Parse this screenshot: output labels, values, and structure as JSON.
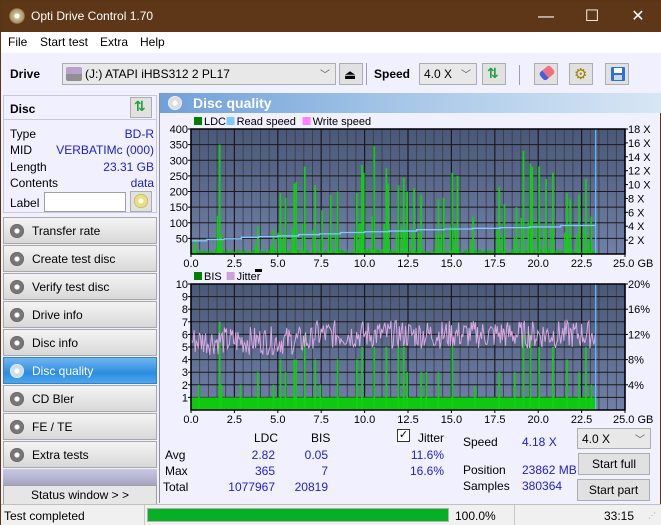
{
  "window": {
    "title": "Opti Drive Control 1.70",
    "minimize": "—",
    "maximize": "☐",
    "close": "✕"
  },
  "menu": [
    "File",
    "Start test",
    "Extra",
    "Help"
  ],
  "toolbar": {
    "drive_label": "Drive",
    "drive_value": "(J:)  ATAPI iHBS312   2 PL17",
    "speed_label": "Speed",
    "speed_value": "4.0 X",
    "icons": [
      "eject-icon",
      "refresh-icon",
      "eraser-icon",
      "settings-icon",
      "save-icon"
    ]
  },
  "disc": {
    "title": "Disc",
    "rows": [
      {
        "key": "Type",
        "value": "BD-R"
      },
      {
        "key": "MID",
        "value": "VERBATIMc (000)"
      },
      {
        "key": "Length",
        "value": "23.31 GB"
      },
      {
        "key": "Contents",
        "value": "data"
      }
    ],
    "label_key": "Label",
    "label_value": ""
  },
  "nav": [
    {
      "label": "Transfer rate",
      "active": false
    },
    {
      "label": "Create test disc",
      "active": false
    },
    {
      "label": "Verify test disc",
      "active": false
    },
    {
      "label": "Drive info",
      "active": false
    },
    {
      "label": "Disc info",
      "active": false
    },
    {
      "label": "Disc quality",
      "active": true
    },
    {
      "label": "CD Bler",
      "active": false
    },
    {
      "label": "FE / TE",
      "active": false
    },
    {
      "label": "Extra tests",
      "active": false
    }
  ],
  "status_window_label": "Status window > >",
  "panel_title": "Disc quality",
  "chart_data": [
    {
      "type": "bar",
      "title": "LDC / Read speed",
      "legend": [
        "LDC",
        "Read speed",
        "Write speed"
      ],
      "legend_colors": [
        "#008000",
        "#80c8ff",
        "#ff80ff"
      ],
      "xlim": [
        0,
        25
      ],
      "x_ticks": [
        "0.0",
        "2.5",
        "5.0",
        "7.5",
        "10.0",
        "12.5",
        "15.0",
        "17.5",
        "20.0",
        "22.5",
        "25.0 GB"
      ],
      "ylim": [
        0,
        400
      ],
      "y_ticks": [
        "50",
        "100",
        "150",
        "200",
        "250",
        "300",
        "350",
        "400"
      ],
      "y2lim": [
        0,
        18
      ],
      "y2_ticks": [
        "2 X",
        "4 X",
        "6 X",
        "8 X",
        "10 X",
        "12 X",
        "14 X",
        "16 X",
        "18 X"
      ],
      "end_position_gb": 23.31,
      "ldc_peaks": [
        [
          0.2,
          40
        ],
        [
          1.6,
          350
        ],
        [
          1.7,
          60
        ],
        [
          3.8,
          90
        ],
        [
          4.7,
          80
        ],
        [
          5.1,
          195
        ],
        [
          5.4,
          180
        ],
        [
          5.9,
          225
        ],
        [
          6.0,
          230
        ],
        [
          6.5,
          280
        ],
        [
          7.1,
          220
        ],
        [
          7.5,
          140
        ],
        [
          8.0,
          190
        ],
        [
          8.4,
          200
        ],
        [
          9.5,
          195
        ],
        [
          9.8,
          285
        ],
        [
          9.9,
          260
        ],
        [
          10.5,
          345
        ],
        [
          11.2,
          275
        ],
        [
          11.3,
          225
        ],
        [
          11.9,
          220
        ],
        [
          12.2,
          245
        ],
        [
          12.4,
          200
        ],
        [
          12.8,
          210
        ],
        [
          13.2,
          190
        ],
        [
          14.2,
          175
        ],
        [
          14.5,
          180
        ],
        [
          15.0,
          260
        ],
        [
          15.3,
          250
        ],
        [
          16.2,
          120
        ],
        [
          17.7,
          215
        ],
        [
          18.0,
          160
        ],
        [
          18.7,
          150
        ],
        [
          19.1,
          330
        ],
        [
          19.5,
          290
        ],
        [
          19.6,
          280
        ],
        [
          20.0,
          280
        ],
        [
          20.4,
          240
        ],
        [
          20.8,
          260
        ],
        [
          21.6,
          195
        ],
        [
          21.8,
          175
        ],
        [
          22.3,
          190
        ],
        [
          22.7,
          240
        ],
        [
          23.0,
          120
        ]
      ],
      "read_speed_steps": [
        [
          0,
          1.9
        ],
        [
          0.9,
          2.1
        ],
        [
          1.9,
          2.2
        ],
        [
          2.9,
          2.4
        ],
        [
          3.9,
          2.5
        ],
        [
          5.0,
          2.6
        ],
        [
          6.2,
          2.8
        ],
        [
          7.4,
          2.9
        ],
        [
          8.6,
          3.1
        ],
        [
          10.0,
          3.2
        ],
        [
          11.4,
          3.3
        ],
        [
          13.0,
          3.5
        ],
        [
          14.6,
          3.6
        ],
        [
          16.2,
          3.7
        ],
        [
          17.8,
          3.8
        ],
        [
          19.5,
          3.9
        ],
        [
          21.3,
          4.1
        ],
        [
          23.31,
          4.1
        ]
      ]
    },
    {
      "type": "bar",
      "title": "BIS / Jitter",
      "legend": [
        "BIS",
        "Jitter"
      ],
      "legend_colors": [
        "#008000",
        "#d0a0d8"
      ],
      "xlim": [
        0,
        25
      ],
      "x_ticks": [
        "0.0",
        "2.5",
        "5.0",
        "7.5",
        "10.0",
        "12.5",
        "15.0",
        "17.5",
        "20.0",
        "22.5",
        "25.0 GB"
      ],
      "ylim": [
        0,
        10
      ],
      "y_ticks": [
        "1",
        "2",
        "3",
        "4",
        "5",
        "6",
        "7",
        "8",
        "9",
        "10"
      ],
      "y2lim": [
        0,
        20
      ],
      "y2_ticks": [
        "4%",
        "8%",
        "12%",
        "16%",
        "20%"
      ],
      "end_position_gb": 23.31,
      "bis_baseline": 1,
      "bis_peaks": [
        [
          0.4,
          2
        ],
        [
          1.6,
          7
        ],
        [
          1.7,
          2
        ],
        [
          2.8,
          2
        ],
        [
          3.8,
          3
        ],
        [
          4.7,
          2
        ],
        [
          5.1,
          4
        ],
        [
          5.4,
          3
        ],
        [
          5.9,
          4
        ],
        [
          6.0,
          4
        ],
        [
          6.5,
          6
        ],
        [
          7.1,
          4
        ],
        [
          7.4,
          2
        ],
        [
          8.4,
          4
        ],
        [
          9.5,
          4
        ],
        [
          9.8,
          5
        ],
        [
          10.5,
          5
        ],
        [
          11.2,
          5
        ],
        [
          11.9,
          5
        ],
        [
          12.2,
          5
        ],
        [
          12.4,
          3
        ],
        [
          13.2,
          3
        ],
        [
          13.5,
          3
        ],
        [
          14.2,
          3
        ],
        [
          15.0,
          5
        ],
        [
          16.3,
          1.9
        ],
        [
          17.7,
          3
        ],
        [
          18.6,
          3
        ],
        [
          19.1,
          6
        ],
        [
          19.5,
          6
        ],
        [
          20.0,
          5
        ],
        [
          20.8,
          5
        ],
        [
          21.6,
          4
        ],
        [
          22.3,
          3
        ],
        [
          22.7,
          5
        ],
        [
          23.0,
          2
        ]
      ],
      "jitter_range_percent": [
        9,
        16.6
      ]
    }
  ],
  "stats": {
    "col_ldc": "LDC",
    "col_bis": "BIS",
    "jitter_label": "Jitter",
    "jitter_checked": true,
    "rows": [
      {
        "label": "Avg",
        "ldc": "2.82",
        "bis": "0.05",
        "jitter": "11.6%"
      },
      {
        "label": "Max",
        "ldc": "365",
        "bis": "7",
        "jitter": "16.6%"
      },
      {
        "label": "Total",
        "ldc": "1077967",
        "bis": "20819",
        "jitter": ""
      }
    ],
    "speed_label": "Speed",
    "speed_value": "4.18 X",
    "position_label": "Position",
    "position_value": "23862 MB",
    "samples_label": "Samples",
    "samples_value": "380364",
    "speed_select": "4.0 X",
    "start_full": "Start full",
    "start_part": "Start part"
  },
  "statusbar": {
    "text": "Test completed",
    "progress_percent": 100.0,
    "progress_label": "100.0%",
    "time": "33:15"
  }
}
